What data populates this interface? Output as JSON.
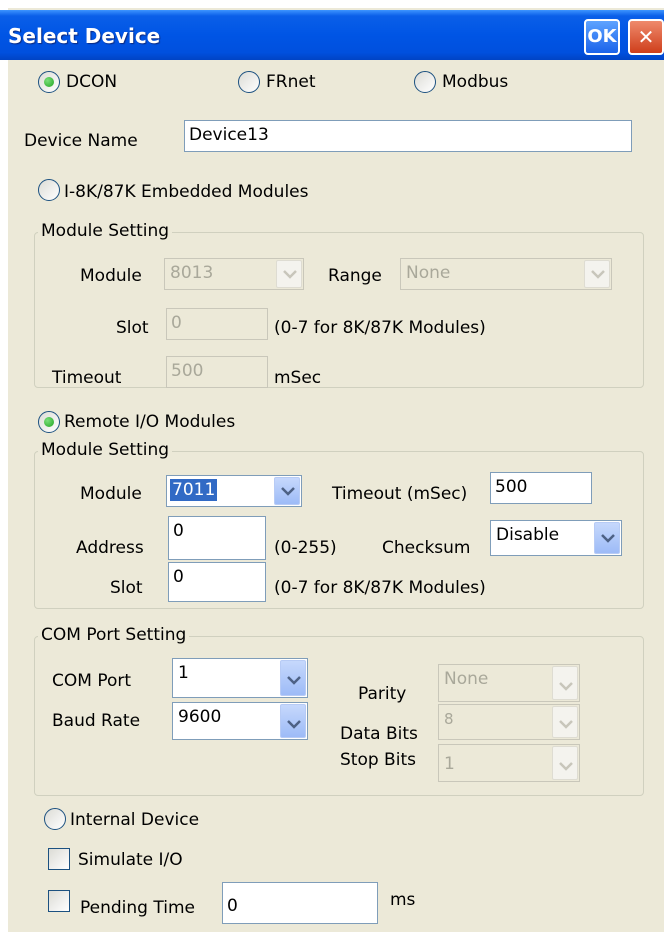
{
  "window": {
    "title": "Select Device",
    "ok_label": "OK",
    "close_glyph": "✕"
  },
  "protocol": {
    "options": [
      "DCON",
      "FRnet",
      "Modbus"
    ],
    "selected": "DCON"
  },
  "device_name": {
    "label": "Device Name",
    "value": "Device13"
  },
  "embedded": {
    "radio_label": "I-8K/87K Embedded Modules",
    "selected": false,
    "group_title": "Module Setting",
    "module_label": "Module",
    "module_value": "8013",
    "range_label": "Range",
    "range_value": "None",
    "slot_label": "Slot",
    "slot_value": "0",
    "slot_hint": "(0-7 for 8K/87K Modules)",
    "timeout_label": "Timeout",
    "timeout_value": "500",
    "timeout_unit": "mSec"
  },
  "remote": {
    "radio_label": "Remote I/O Modules",
    "selected": true,
    "group_title": "Module Setting",
    "module_label": "Module",
    "module_value": "7011",
    "timeout_label": "Timeout (mSec)",
    "timeout_value": "500",
    "address_label": "Address",
    "address_value": "0",
    "address_hint": "(0-255)",
    "checksum_label": "Checksum",
    "checksum_value": "Disable",
    "slot_label": "Slot",
    "slot_value": "0",
    "slot_hint": "(0-7 for 8K/87K Modules)"
  },
  "com": {
    "group_title": "COM Port Setting",
    "port_label": "COM Port",
    "port_value": "1",
    "baud_label": "Baud Rate",
    "baud_value": "9600",
    "parity_label": "Parity",
    "parity_value": "None",
    "databits_label": "Data Bits",
    "databits_value": "8",
    "stopbits_label": "Stop Bits",
    "stopbits_value": "1"
  },
  "internal": {
    "radio_label": "Internal Device",
    "selected": false
  },
  "simulate": {
    "label": "Simulate I/O",
    "checked": false
  },
  "pending": {
    "label": "Pending Time",
    "value": "0",
    "unit": "ms",
    "checked": false
  }
}
